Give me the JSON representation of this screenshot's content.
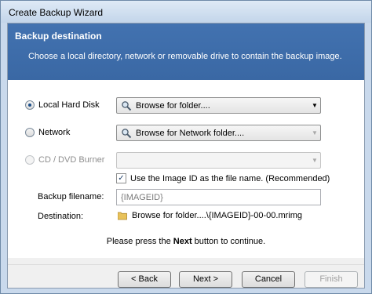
{
  "window": {
    "title": "Create Backup Wizard"
  },
  "banner": {
    "title": "Backup destination",
    "description": "Choose a local directory, network  or removable drive to contain the backup image."
  },
  "options": {
    "local": {
      "label": "Local Hard Disk",
      "dropdown": "Browse for folder...."
    },
    "network": {
      "label": "Network",
      "dropdown": "Browse for Network folder...."
    },
    "cd": {
      "label": "CD / DVD Burner",
      "dropdown": ""
    }
  },
  "image_id_checkbox": {
    "label": "Use the Image ID as the file name.  (Recommended)",
    "checked": true
  },
  "backup_filename": {
    "label": "Backup filename:",
    "value": "{IMAGEID}"
  },
  "destination": {
    "label": "Destination:",
    "value": "Browse for folder....\\{IMAGEID}-00-00.mrimg"
  },
  "note": {
    "prefix": "Please press the ",
    "bold": "Next",
    "suffix": " button to continue."
  },
  "buttons": {
    "back": "< Back",
    "next": "Next >",
    "cancel": "Cancel",
    "finish": "Finish"
  },
  "colors": {
    "banner": "#3e6ea8",
    "selected_radio": "#1b4f8a"
  }
}
